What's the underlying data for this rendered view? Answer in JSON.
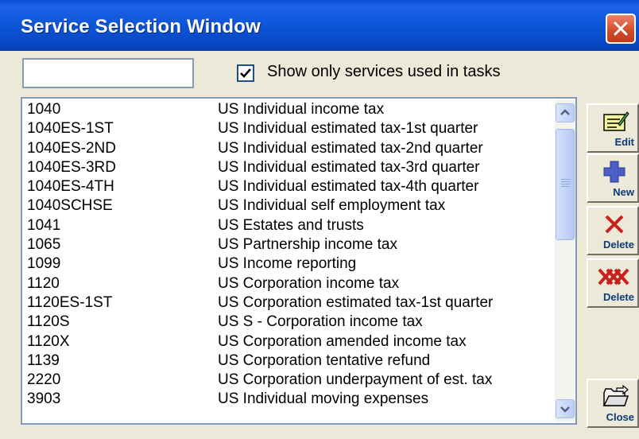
{
  "window": {
    "title": "Service Selection Window"
  },
  "search": {
    "value": "",
    "placeholder": ""
  },
  "filter": {
    "label": "Show only services used in tasks",
    "checked": true
  },
  "services": [
    {
      "code": "1040",
      "description": "US Individual income tax"
    },
    {
      "code": "1040ES-1ST",
      "description": "US Individual estimated tax-1st quarter"
    },
    {
      "code": "1040ES-2ND",
      "description": "US Individual estimated tax-2nd quarter"
    },
    {
      "code": "1040ES-3RD",
      "description": "US Individual estimated tax-3rd quarter"
    },
    {
      "code": "1040ES-4TH",
      "description": "US Individual estimated tax-4th quarter"
    },
    {
      "code": "1040SCHSE",
      "description": "US Individual self employment tax"
    },
    {
      "code": "1041",
      "description": "US Estates and trusts"
    },
    {
      "code": "1065",
      "description": "US Partnership income tax"
    },
    {
      "code": "1099",
      "description": "US Income reporting"
    },
    {
      "code": "1120",
      "description": "US Corporation income tax"
    },
    {
      "code": "1120ES-1ST",
      "description": "US Corporation estimated tax-1st quarter"
    },
    {
      "code": "1120S",
      "description": "US S - Corporation income tax"
    },
    {
      "code": "1120X",
      "description": "US Corporation amended income tax"
    },
    {
      "code": "1139",
      "description": "US Corporation tentative refund"
    },
    {
      "code": "2220",
      "description": "US Corporation underpayment of est. tax"
    },
    {
      "code": "3903",
      "description": "US Individual moving expenses"
    }
  ],
  "toolbar": {
    "edit_label": "Edit",
    "new_label": "New",
    "delete_label": "Delete",
    "delete_all_label": "Delete",
    "close_label": "Close"
  },
  "colors": {
    "titlebar": "#0a4fd6",
    "close_button": "#d04a28",
    "list_text": "#000000",
    "button_label": "#0d3b7a"
  },
  "icons": {
    "close": "close-x-icon",
    "edit": "edit-pencil-icon",
    "new": "plus-icon",
    "delete": "delete-x-icon",
    "delete_all": "delete-all-icon",
    "close_folder": "folder-close-icon"
  }
}
